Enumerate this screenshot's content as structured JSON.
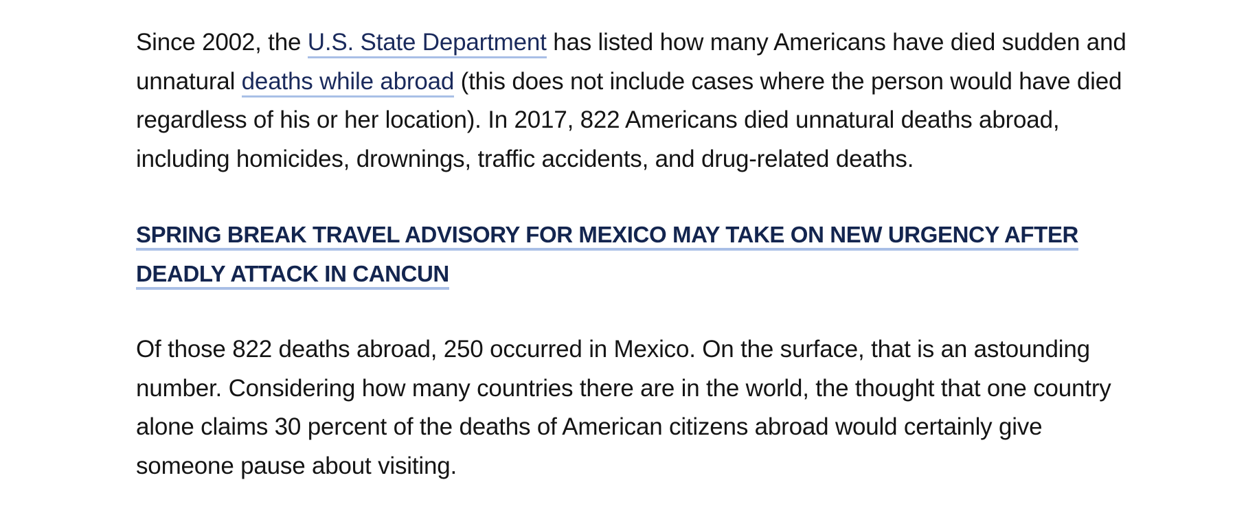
{
  "article": {
    "paragraph1": {
      "part1": "Since 2002, the ",
      "link1": "U.S. State Department",
      "part2": " has listed how many Americans have died sudden and unnatural ",
      "link2": "deaths while abroad",
      "part3": " (this does not include cases where the person would have died regardless of his or her location). In 2017, 822 Americans died unnatural deaths abroad, including homicides, drownings, traffic accidents, and drug-related deaths."
    },
    "related_headline": "SPRING BREAK TRAVEL ADVISORY FOR MEXICO MAY TAKE ON NEW URGENCY AFTER DEADLY ATTACK IN CANCUN",
    "paragraph2": "Of those 822 deaths abroad, 250 occurred in Mexico. On the surface, that is an astounding number. Considering how many countries there are in the world, the thought that one country alone claims 30 percent of the deaths of American citizens abroad would certainly give someone pause about visiting."
  },
  "colors": {
    "link_text": "#1a2a5c",
    "headline_text": "#13254f",
    "link_underline": "#a9bfe6",
    "body_text": "#141414"
  }
}
